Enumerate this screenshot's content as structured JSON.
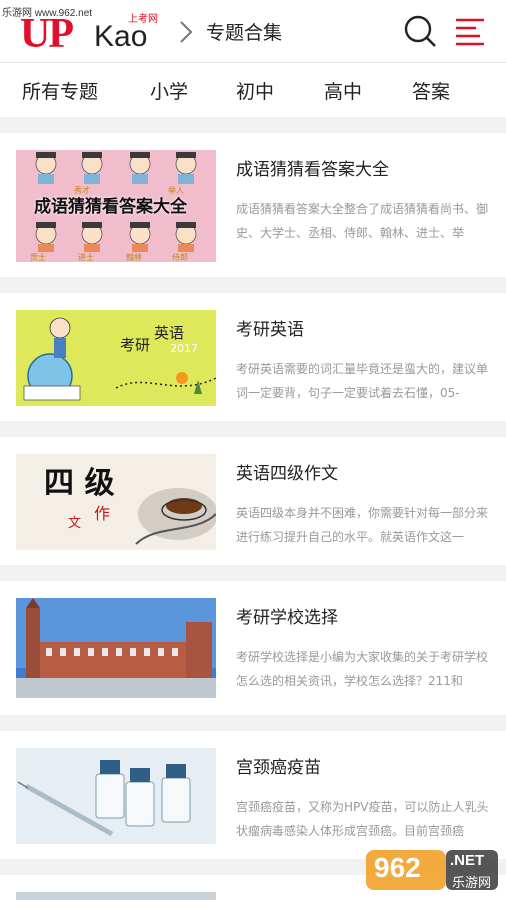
{
  "watermark_top": "乐游网 www.962.net",
  "header": {
    "logo_up": "UP",
    "logo_kao": "Kao",
    "logo_sub": "上考网",
    "title": "专题合集"
  },
  "tabs": [
    "所有专题",
    "小学",
    "初中",
    "高中",
    "答案"
  ],
  "cards": [
    {
      "title": "成语猜猜看答案大全",
      "desc": "成语猜猜看答案大全整合了成语猜猜看尚书、御史、大学士、丞相、侍郎、翰林、进士、举",
      "thumb_text": "成语猜猜看答案大全",
      "thumb_labels": [
        "秀才",
        "举人",
        "贡士",
        "进士",
        "翰林",
        "侍郎"
      ]
    },
    {
      "title": "考研英语",
      "desc": "考研英语需要的词汇量毕竟还是蛮大的，建议单词一定要背，句子一定要试着去石懂，05-",
      "thumb_text_1": "考研",
      "thumb_text_2": "英语",
      "thumb_year": "2017"
    },
    {
      "title": "英语四级作文",
      "desc": "英语四级本身并不困难，你需要针对每一部分来进行练习提升自己的水平。就英语作文这一",
      "thumb_big": "四 级",
      "thumb_small_1": "作",
      "thumb_small_2": "文"
    },
    {
      "title": "考研学校选择",
      "desc": "考研学校选择是小编为大家收集的关于考研学校怎么选的相关资讯，学校怎么选择？211和"
    },
    {
      "title": "宫颈癌疫苗",
      "desc": "宫颈癌疫苗，又称为HPV疫苗，可以防止人乳头状瘤病毒感染人体形成宫颈癌。目前宫颈癌"
    }
  ],
  "watermark_bottom": {
    "number": "962",
    "suffix": ".NET",
    "cn": "乐游网"
  },
  "colors": {
    "brand": "#e0102a",
    "page_bg": "#f1f1f1"
  }
}
